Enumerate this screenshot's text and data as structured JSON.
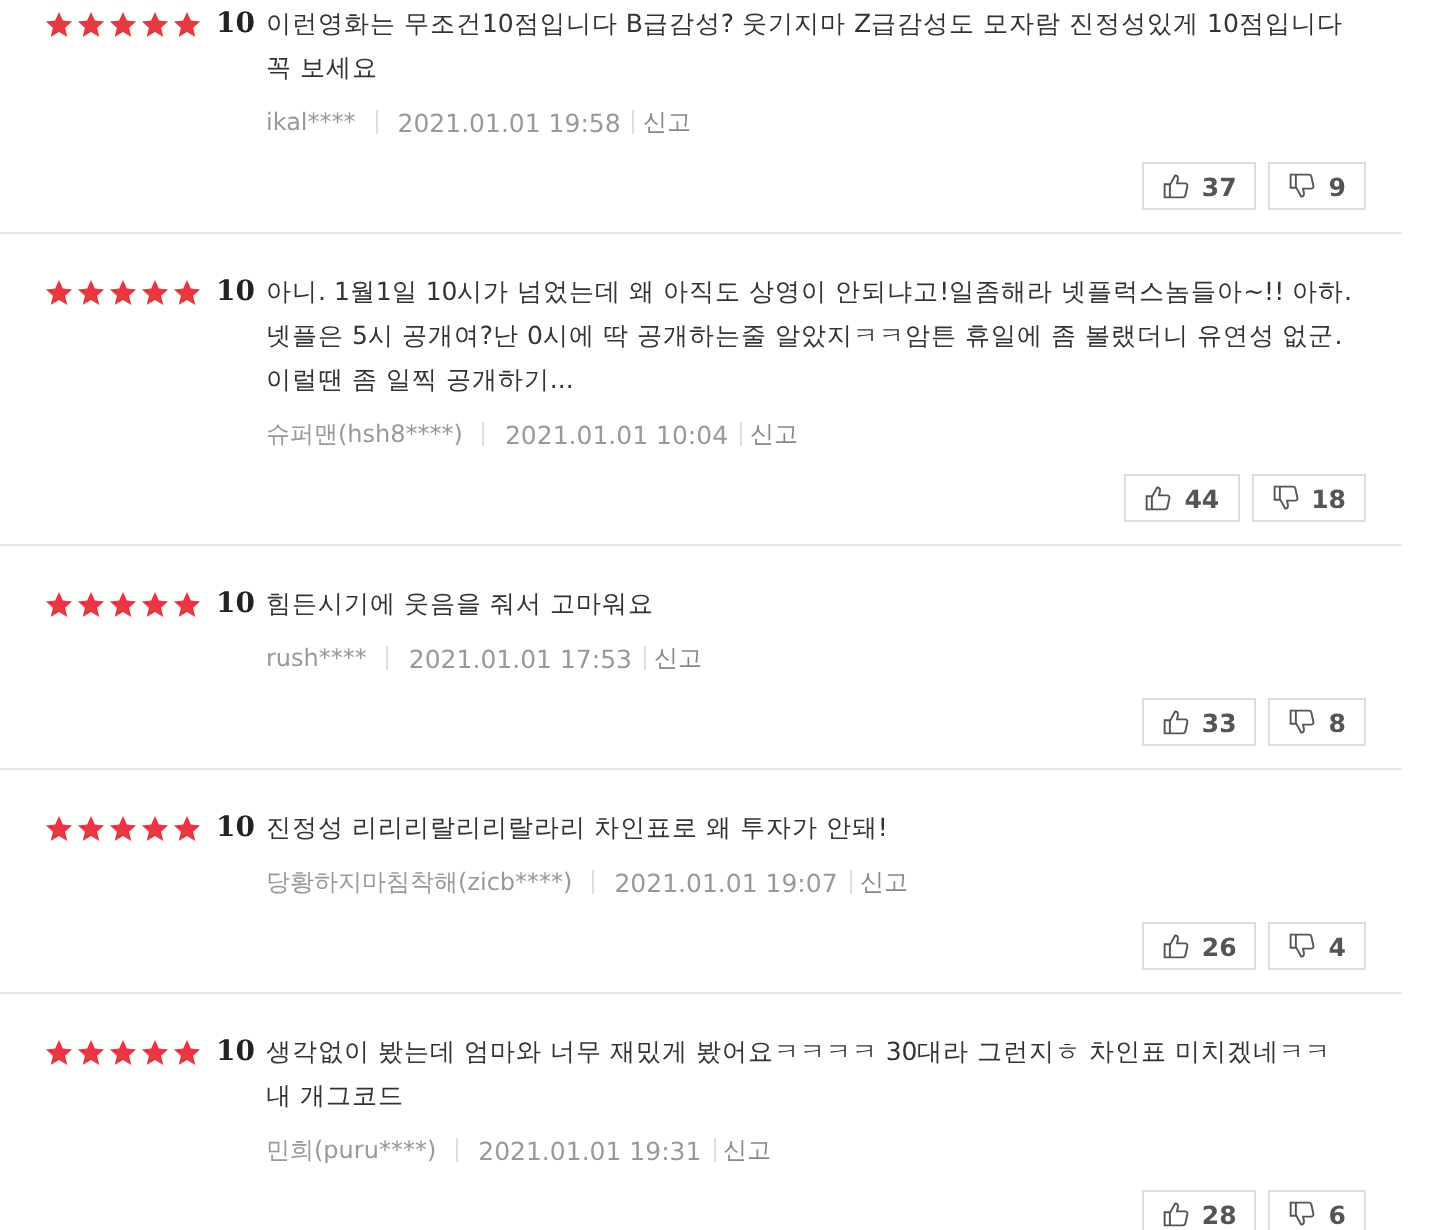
{
  "reviews": [
    {
      "stars": 5,
      "score": "10",
      "lines": [
        "이런영화는 무조건10점입니다 B급감성? 웃기지마 Z급감성도 모자람 진정성있게 10점입니다",
        "꼭 보세요"
      ],
      "author": "ikal****",
      "date": "2021.01.01 19:58",
      "report": "신고",
      "likes": "37",
      "dislikes": "9"
    },
    {
      "stars": 5,
      "score": "10",
      "lines": [
        "아니. 1월1일 10시가 넘었는데 왜 아직도 상영이 안되냐고!일좀해라 넷플럭스놈들아~!! 아하.",
        "넷플은 5시 공개여?난 0시에 딱 공개하는줄 알았지ㅋㅋ암튼 휴일에 좀 볼랬더니 유연성 없군.",
        "이럴땐 좀 일찍 공개하기..."
      ],
      "author": "슈퍼맨(hsh8****)",
      "date": "2021.01.01 10:04",
      "report": "신고",
      "likes": "44",
      "dislikes": "18"
    },
    {
      "stars": 5,
      "score": "10",
      "lines": [
        "힘든시기에 웃음을 줘서 고마워요"
      ],
      "author": "rush****",
      "date": "2021.01.01 17:53",
      "report": "신고",
      "likes": "33",
      "dislikes": "8"
    },
    {
      "stars": 5,
      "score": "10",
      "lines": [
        "진정성 리리리랄리리랄라리 차인표로 왜 투자가 안돼!"
      ],
      "author": "당황하지마침착해(zicb****)",
      "date": "2021.01.01 19:07",
      "report": "신고",
      "likes": "26",
      "dislikes": "4"
    },
    {
      "stars": 5,
      "score": "10",
      "lines": [
        "생각없이 봤는데 엄마와 너무 재밌게 봤어요ㅋㅋㅋㅋ 30대라 그런지ㅎ 차인표 미치겠네ㅋㅋ",
        "내 개그코드"
      ],
      "author": "민희(puru****)",
      "date": "2021.01.01 19:31",
      "report": "신고",
      "likes": "28",
      "dislikes": "6"
    }
  ]
}
